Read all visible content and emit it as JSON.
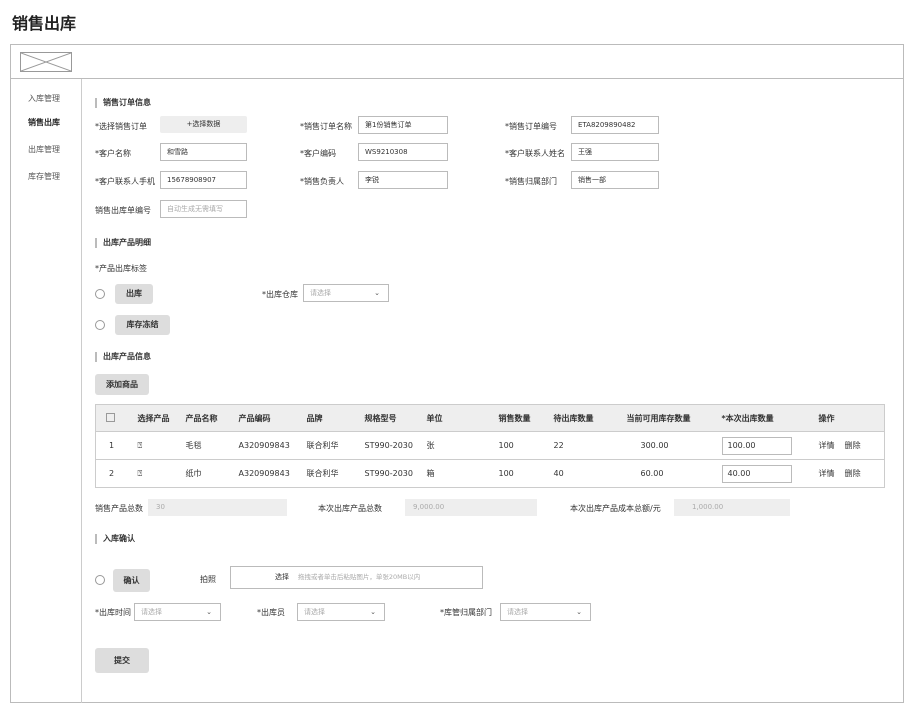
{
  "page_title": "销售出库",
  "sidebar": [
    "入库管理",
    "销售出库",
    "出库管理",
    "库存管理"
  ],
  "order_section": {
    "title": "销售订单信息",
    "select_order_label": "*选择销售订单",
    "select_order_button": "+选择数据",
    "order_name_label": "*销售订单名称",
    "order_name": "第1份销售订单",
    "order_no_label": "*销售订单编号",
    "order_no": "ETA8209890482",
    "customer_name_label": "*客户名称",
    "customer_name": "和雪路",
    "customer_code_label": "*客户编码",
    "customer_code": "WS9210308",
    "contact_name_label": "*客户联系人姓名",
    "contact_name": "王强",
    "contact_phone_label": "*客户联系人手机",
    "contact_phone": "15678908907",
    "sales_owner_label": "*销售负责人",
    "sales_owner": "李锐",
    "sales_dept_label": "*销售归属部门",
    "sales_dept": "销售一部",
    "outbound_no_label": "销售出库单编号",
    "outbound_no_placeholder": "自动生成无需填写"
  },
  "detail_section": {
    "title": "出库产品明细",
    "tag_label": "*产品出库标签",
    "opt1": "出库",
    "opt2": "库存冻结",
    "warehouse_label": "*出库仓库",
    "warehouse_placeholder": "请选择"
  },
  "product_section": {
    "title": "出库产品信息",
    "add_button": "添加商品",
    "columns": [
      "选择产品",
      "产品名称",
      "产品编码",
      "品牌",
      "规格型号",
      "单位",
      "销售数量",
      "待出库数量",
      "当前可用库存数量",
      "*本次出库数量",
      "操作"
    ],
    "rows": [
      {
        "idx": "1",
        "name": "毛毯",
        "code": "A320909843",
        "brand": "联合利华",
        "spec": "ST990-2030",
        "unit": "张",
        "sold": "100",
        "pending": "22",
        "stock": "300.00",
        "qty": "100.00"
      },
      {
        "idx": "2",
        "name": "纸巾",
        "code": "A320909843",
        "brand": "联合利华",
        "spec": "ST990-2030",
        "unit": "箱",
        "sold": "100",
        "pending": "40",
        "stock": "60.00",
        "qty": "40.00"
      }
    ],
    "detail_link": "详情",
    "delete_link": "删除",
    "total_sold_label": "销售产品总数",
    "total_sold": "30",
    "total_out_label": "本次出库产品总数",
    "total_out": "9,000.00",
    "total_cost_label": "本次出库产品成本总额/元",
    "total_cost": "1,000.00"
  },
  "confirm_section": {
    "title": "入库确认",
    "confirm_button": "确认",
    "photo_label": "拍照",
    "upload_choose": "选择",
    "upload_hint": "拖拽或者单击后粘贴图片，单张20MB以内",
    "time_label": "*出库时间",
    "clerk_label": "*出库员",
    "dept_label": "*库管归属部门",
    "placeholder": "请选择"
  },
  "submit": "提交"
}
